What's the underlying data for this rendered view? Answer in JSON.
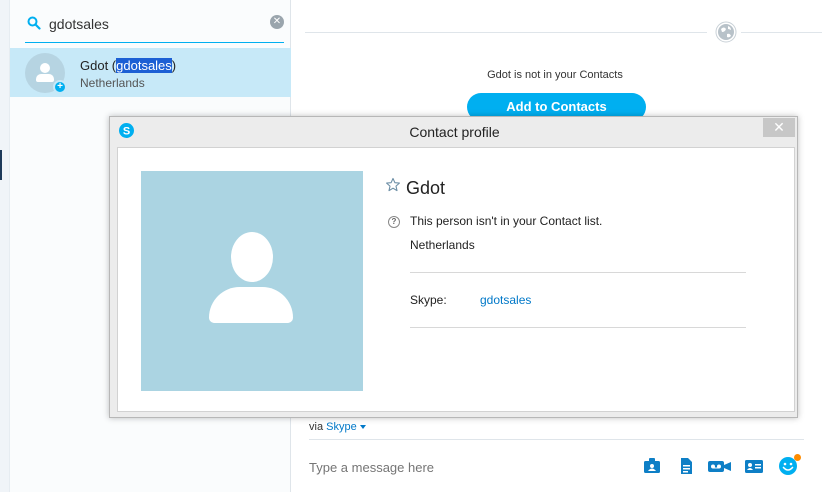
{
  "search": {
    "query": "gdotsales"
  },
  "result": {
    "name": "Gdot",
    "open_paren": " (",
    "username": "gdotsales",
    "close_paren": ")",
    "country": "Netherlands"
  },
  "main": {
    "not_in_contacts": "Gdot is not in your Contacts",
    "add_button": "Add to Contacts",
    "via_label": "via",
    "via_service": "Skype",
    "compose_placeholder": "Type a message here"
  },
  "dialog": {
    "title": "Contact profile",
    "close": "✕",
    "name": "Gdot",
    "status": "This person isn't in your Contact list.",
    "country": "Netherlands",
    "skype_label": "Skype:",
    "skype_username": "gdotsales"
  },
  "colors": {
    "accent": "#00aff0",
    "link": "#0078c8",
    "selection": "#c7e9f8",
    "avatar_bg": "#abd4e2"
  },
  "icons": [
    "search-icon",
    "clear-icon",
    "add-contact-badge-icon",
    "globe-icon",
    "skype-logo-icon",
    "star-icon",
    "question-icon",
    "share-contact-icon",
    "file-icon",
    "video-message-icon",
    "contact-card-icon",
    "emoji-icon"
  ]
}
